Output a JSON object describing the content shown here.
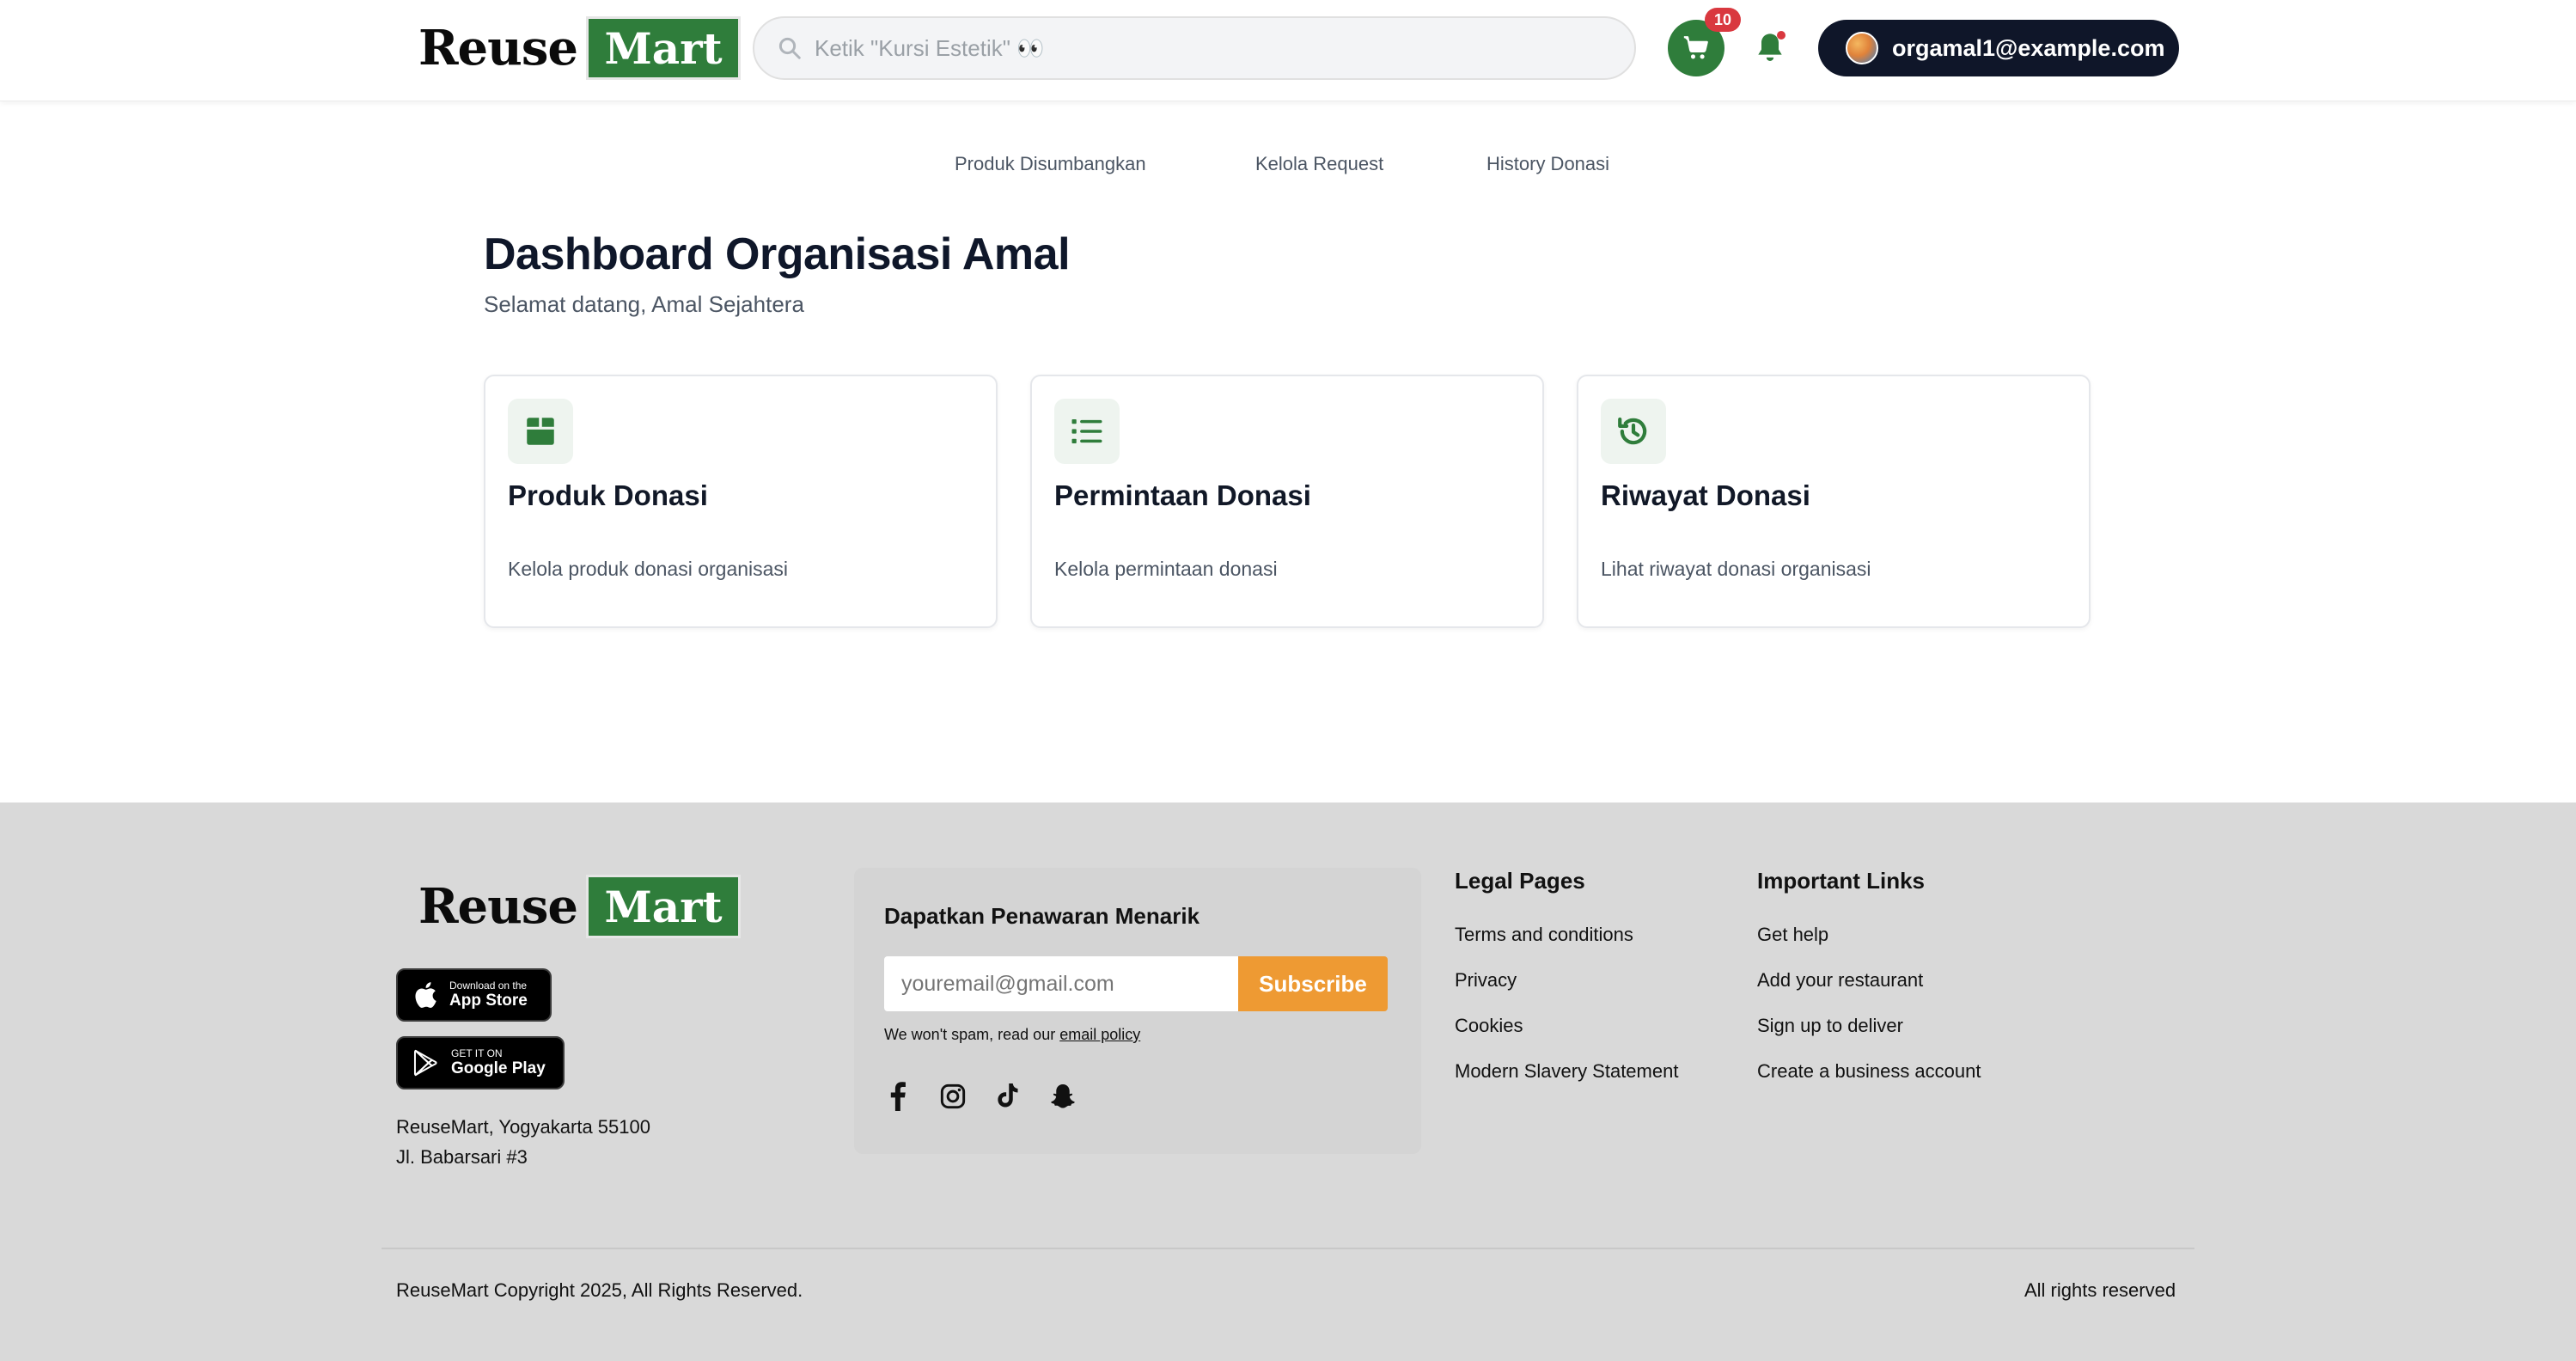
{
  "header": {
    "logo": {
      "part1": "Reuse",
      "part2": "Mart"
    },
    "search": {
      "placeholder": "Ketik \"Kursi Estetik\" 👀"
    },
    "cart_count": "10",
    "user_email": "orgamal1@example.com"
  },
  "subnav": {
    "items": [
      {
        "label": "Produk Disumbangkan"
      },
      {
        "label": "Kelola Request"
      },
      {
        "label": "History Donasi"
      }
    ]
  },
  "main": {
    "title": "Dashboard Organisasi Amal",
    "subtitle": "Selamat datang, Amal Sejahtera",
    "cards": [
      {
        "icon": "box-icon",
        "title": "Produk Donasi",
        "description": "Kelola produk donasi organisasi"
      },
      {
        "icon": "list-icon",
        "title": "Permintaan Donasi",
        "description": "Kelola permintaan donasi"
      },
      {
        "icon": "history-icon",
        "title": "Riwayat Donasi",
        "description": "Lihat riwayat donasi organisasi"
      }
    ]
  },
  "footer": {
    "logo": {
      "part1": "Reuse",
      "part2": "Mart"
    },
    "app_store": {
      "small": "Download on the",
      "big": "App Store"
    },
    "google_play": {
      "small": "GET IT ON",
      "big": "Google Play"
    },
    "address": {
      "line1": "ReuseMart, Yogyakarta 55100",
      "line2": "Jl. Babarsari #3"
    },
    "newsletter": {
      "title": "Dapatkan Penawaran Menarik",
      "placeholder": "youremail@gmail.com",
      "button": "Subscribe",
      "note": "We won't spam, read our",
      "note_link": "email policy"
    },
    "social": [
      "facebook-icon",
      "instagram-icon",
      "tiktok-icon",
      "snapchat-icon"
    ],
    "legal": {
      "title": "Legal Pages",
      "links": [
        "Terms and conditions",
        "Privacy",
        "Cookies",
        "Modern Slavery Statement"
      ]
    },
    "important": {
      "title": "Important Links",
      "links": [
        "Get help",
        "Add your restaurant",
        "Sign up to deliver",
        "Create a business account"
      ]
    },
    "copyright": "ReuseMart Copyright 2025, All Rights Reserved.",
    "all_rights": "All rights reserved"
  },
  "colors": {
    "brand_green": "#2f7d3b",
    "badge_red": "#d9383f",
    "subscribe_orange": "#ee9a33",
    "user_pill": "#0f1629",
    "footer_bg": "#d9d9d9"
  }
}
